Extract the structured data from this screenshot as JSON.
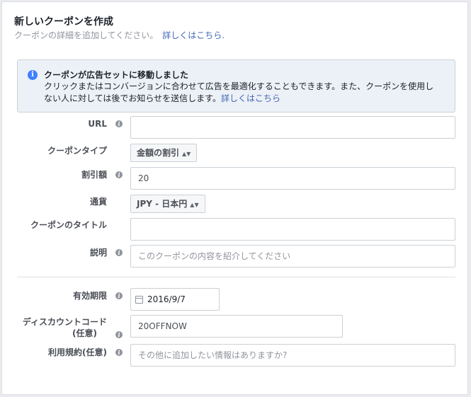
{
  "header": {
    "title": "新しいクーポンを作成",
    "subtitle": "クーポンの詳細を追加してください。",
    "link": "詳しくはこちら."
  },
  "notice": {
    "title": "クーポンが広告セットに移動しました",
    "body": "クリックまたはコンバージョンに合わせて広告を最適化することもできます。また、クーポンを使用しない人に対しては後でお知らせを送信します。",
    "link": "詳しくはこちら"
  },
  "form": {
    "url": {
      "label": "URL",
      "value": ""
    },
    "coupon_type": {
      "label": "クーポンタイプ",
      "value": "金額の割引"
    },
    "discount": {
      "label": "割引額",
      "value": "20"
    },
    "currency": {
      "label": "通貨",
      "value": "JPY - 日本円"
    },
    "coupon_title": {
      "label": "クーポンのタイトル",
      "value": ""
    },
    "description": {
      "label": "説明",
      "placeholder": "このクーポンの内容を紹介してください"
    },
    "expiry": {
      "label": "有効期限",
      "value": "2016/9/7"
    },
    "discount_code": {
      "label_line1": "ディスカウントコード",
      "label_line2": "(任意)",
      "value": "20OFFNOW"
    },
    "terms": {
      "label": "利用規約(任意)",
      "placeholder": "その他に追加したい情報はありますか?"
    }
  },
  "icons": {
    "info": "info-icon",
    "help": "help-icon",
    "calendar": "calendar-icon",
    "dropdown": "sort-arrows-icon"
  }
}
